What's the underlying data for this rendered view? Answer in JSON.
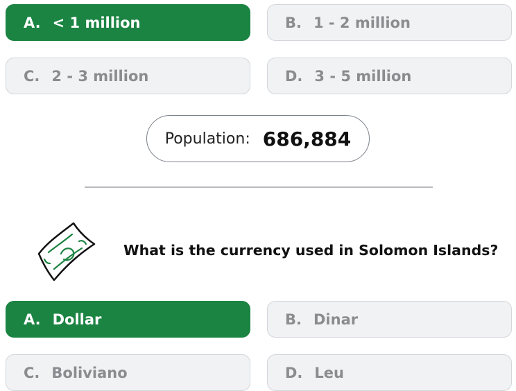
{
  "question1": {
    "options": [
      {
        "letter": "A.",
        "text": "< 1 million"
      },
      {
        "letter": "B.",
        "text": "1 - 2 million"
      },
      {
        "letter": "C.",
        "text": "2 - 3 million"
      },
      {
        "letter": "D.",
        "text": "3 - 5 million"
      }
    ],
    "selected_index": 0
  },
  "population": {
    "label": "Population:",
    "value": "686,884"
  },
  "question2": {
    "icon": "money-icon",
    "text": "What is the currency used in Solomon Islands?",
    "options": [
      {
        "letter": "A.",
        "text": "Dollar"
      },
      {
        "letter": "B.",
        "text": "Dinar"
      },
      {
        "letter": "C.",
        "text": "Boliviano"
      },
      {
        "letter": "D.",
        "text": "Leu"
      }
    ],
    "selected_index": 0
  },
  "colors": {
    "selected_bg": "#1b8442",
    "option_bg": "#f1f2f4",
    "option_text": "#8a8c8f"
  }
}
